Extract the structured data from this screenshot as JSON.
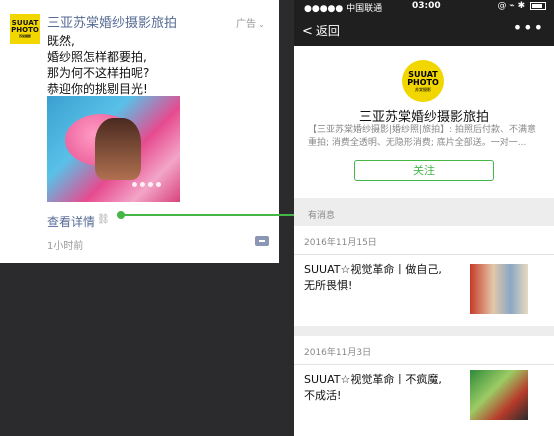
{
  "ad_card": {
    "account_name": "三亚苏棠婚纱摄影旅拍",
    "ad_badge": "广告",
    "logo": {
      "line1": "SUUAT",
      "line2": "PHOTO",
      "line3": "苏棠摄影"
    },
    "text_lines": [
      "既然,",
      "婚纱照怎样都要拍,",
      "那为何不这样拍呢?",
      "恭迎你的挑剔目光!"
    ],
    "details_link": "查看详情",
    "time": "1小时前",
    "icon_names": [
      "link-icon",
      "comment-icon"
    ]
  },
  "phone": {
    "status": {
      "carrier": "●●●●● 中国联通 ",
      "time": "03:00",
      "right": "@ ⌁ ✱"
    },
    "nav": {
      "back_label": "返回",
      "more": "•••"
    },
    "profile": {
      "logo": {
        "line1": "SUUAT",
        "line2": "PHOTO",
        "line3": "苏棠摄影"
      },
      "name": "三亚苏棠婚纱摄影旅拍",
      "description_lines": [
        "【三亚苏棠婚纱摄影|婚纱照|旅拍】: 拍照后付款、不满意",
        "重拍; 消费全透明、无隐形消费; 底片全部送。一对一..."
      ],
      "follow_label": "关注"
    },
    "section_label": "有消息",
    "posts": [
      {
        "date": "2016年11月15日",
        "title_lines": [
          "SUUAT☆视觉革命丨做自己,",
          "无所畏惧!"
        ]
      },
      {
        "date": "2016年11月3日",
        "title_lines": [
          "SUUAT☆视觉革命丨不疯魔,",
          "不成活!"
        ]
      }
    ]
  },
  "colors": {
    "link": "#576b95",
    "accent_green": "#46b648",
    "logo_yellow": "#f2d600"
  }
}
